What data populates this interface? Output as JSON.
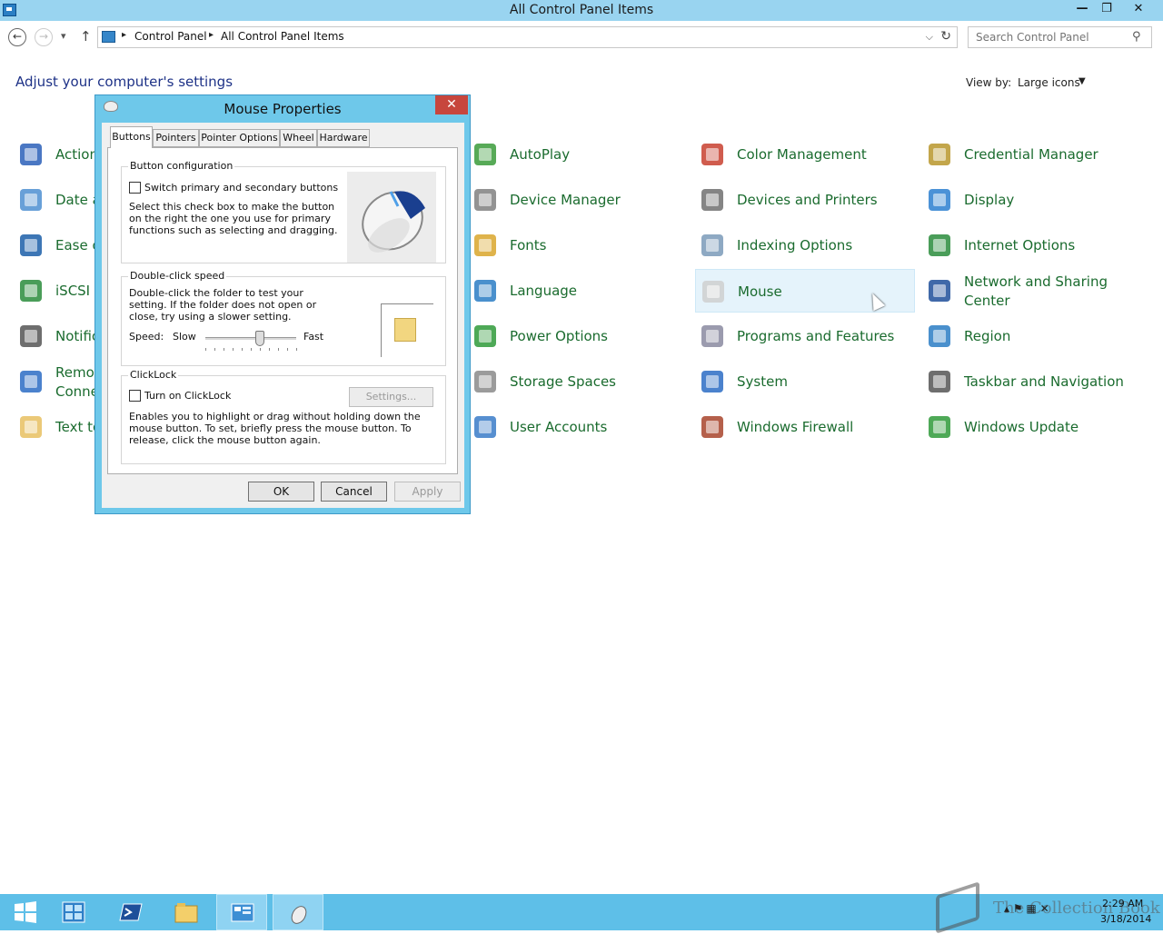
{
  "window": {
    "title": "All Control Panel Items",
    "minimize": "—",
    "maximize": "❐",
    "close": "✕"
  },
  "nav": {
    "back": "←",
    "forward": "→",
    "history": "▾",
    "up": "↑"
  },
  "address": {
    "crumbs": [
      "Control Panel",
      "All Control Panel Items"
    ],
    "dropdown": "⌵",
    "refresh": "↻"
  },
  "search": {
    "placeholder": "Search Control Panel",
    "icon": "search-icon"
  },
  "header": {
    "title": "Adjust your computer's settings",
    "view_by_label": "View by:",
    "view_by_value": "Large icons"
  },
  "items": [
    {
      "label": "Action",
      "icon": "action-center-icon"
    },
    {
      "label": "Date a",
      "icon": "date-time-icon"
    },
    {
      "label": "Ease o",
      "icon": "ease-of-access-icon"
    },
    {
      "label": "iSCSI I",
      "icon": "iscsi-icon"
    },
    {
      "label": "Notific",
      "icon": "notification-icons-icon"
    },
    {
      "label": "Remo\nConne",
      "icon": "remote-connections-icon"
    },
    {
      "label": "Text to",
      "icon": "text-to-speech-icon"
    },
    {
      "label": "AutoPlay",
      "icon": "autoplay-icon"
    },
    {
      "label": "Device Manager",
      "icon": "device-manager-icon"
    },
    {
      "label": "Fonts",
      "icon": "fonts-icon"
    },
    {
      "label": "Language",
      "icon": "language-icon"
    },
    {
      "label": "Power Options",
      "icon": "power-options-icon"
    },
    {
      "label": "Storage Spaces",
      "icon": "storage-spaces-icon"
    },
    {
      "label": "User Accounts",
      "icon": "user-accounts-icon"
    },
    {
      "label": "Color Management",
      "icon": "color-management-icon"
    },
    {
      "label": "Devices and Printers",
      "icon": "devices-printers-icon"
    },
    {
      "label": "Indexing Options",
      "icon": "indexing-options-icon"
    },
    {
      "label": "Mouse",
      "icon": "mouse-icon"
    },
    {
      "label": "Programs and Features",
      "icon": "programs-features-icon"
    },
    {
      "label": "System",
      "icon": "system-icon"
    },
    {
      "label": "Windows Firewall",
      "icon": "windows-firewall-icon"
    },
    {
      "label": "Credential Manager",
      "icon": "credential-manager-icon"
    },
    {
      "label": "Display",
      "icon": "display-icon"
    },
    {
      "label": "Internet Options",
      "icon": "internet-options-icon"
    },
    {
      "label": "Network and Sharing Center",
      "icon": "network-sharing-icon"
    },
    {
      "label": "Region",
      "icon": "region-icon"
    },
    {
      "label": "Taskbar and Navigation",
      "icon": "taskbar-navigation-icon"
    },
    {
      "label": "Windows Update",
      "icon": "windows-update-icon"
    }
  ],
  "dialog": {
    "title": "Mouse Properties",
    "close": "✕",
    "tabs": [
      "Buttons",
      "Pointers",
      "Pointer Options",
      "Wheel",
      "Hardware"
    ],
    "button_config": {
      "label": "Button configuration",
      "checkbox": "Switch primary and secondary buttons",
      "checked": false,
      "description": "Select this check box to make the button on the right the one you use for primary functions such as selecting and dragging."
    },
    "double_click": {
      "label": "Double-click speed",
      "description": "Double-click the folder to test your setting. If the folder does not open or close, try using a slower setting.",
      "speed_label": "Speed:",
      "slow": "Slow",
      "fast": "Fast",
      "speed_value": 0.6
    },
    "clicklock": {
      "label": "ClickLock",
      "checkbox": "Turn on ClickLock",
      "checked": false,
      "settings": "Settings...",
      "description": "Enables you to highlight or drag without holding down the mouse button. To set, briefly press the mouse button. To release, click the mouse button again."
    },
    "buttons": {
      "ok": "OK",
      "cancel": "Cancel",
      "apply": "Apply"
    }
  },
  "taskbar": {
    "items": [
      "start-icon",
      "server-manager-icon",
      "powershell-icon",
      "file-explorer-icon",
      "control-panel-icon",
      "mouse-properties-icon"
    ],
    "tray": "▴ ⚑ ▦ ✕",
    "time": "2:29 AM",
    "date": "3/18/2014",
    "watermark": "The Collection Book"
  },
  "colors": {
    "link_green": "#1a6b2e",
    "title_blue": "#1e3287",
    "taskbar": "#5ebfe8",
    "dialog_frame": "#6ec8ea",
    "close_red": "#c7463d"
  }
}
